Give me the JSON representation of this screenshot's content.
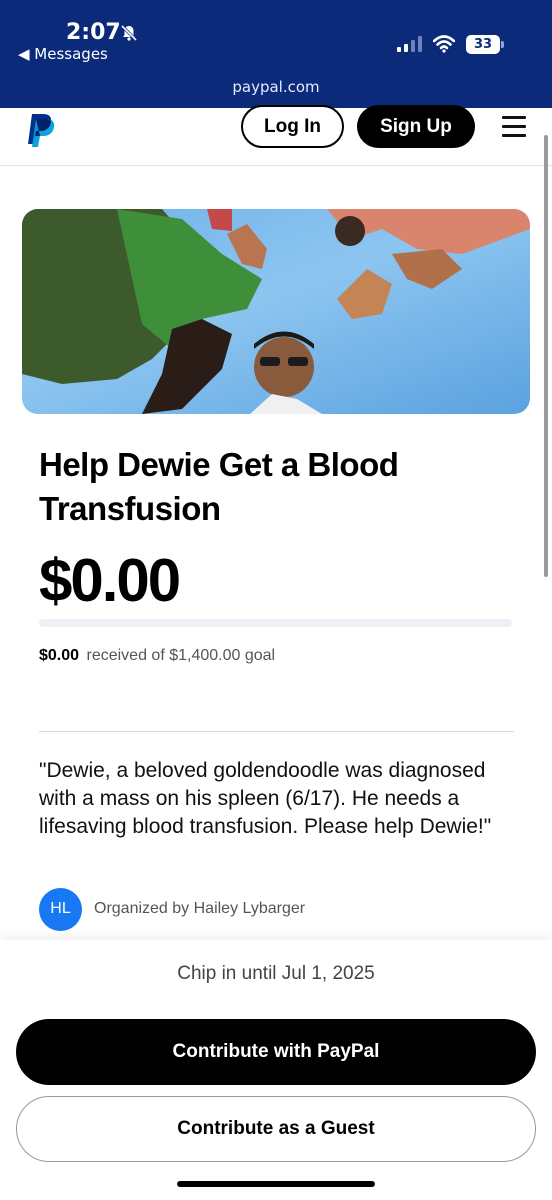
{
  "status_bar": {
    "time": "2:07",
    "back_label": "◀ Messages",
    "battery": "33",
    "url": "paypal.com"
  },
  "header": {
    "login_label": "Log In",
    "signup_label": "Sign Up"
  },
  "campaign": {
    "title": "Help Dewie Get a Blood Transfusion",
    "amount_raised": "$0.00",
    "progress_fraction": 0,
    "received_amount": "$0.00",
    "received_suffix": "received of $1,400.00 goal",
    "description": "\"Dewie, a beloved goldendoodle was diagnosed with a mass on his spleen (6/17). He needs a lifesaving blood transfusion. Please help Dewie!\"",
    "organizer_initials": "HL",
    "organizer_text": "Organized by Hailey Lybarger"
  },
  "footer": {
    "chip_in_text": "Chip in until Jul 1, 2025",
    "contribute_paypal_label": "Contribute with PayPal",
    "contribute_guest_label": "Contribute as a Guest"
  },
  "colors": {
    "status_bar_bg": "#0b2a7a",
    "avatar_bg": "#1877f2",
    "primary_button": "#000000"
  },
  "icons": [
    "bell-slash-icon",
    "signal-icon",
    "wifi-icon",
    "battery-icon",
    "paypal-logo-icon",
    "hamburger-menu-icon"
  ]
}
